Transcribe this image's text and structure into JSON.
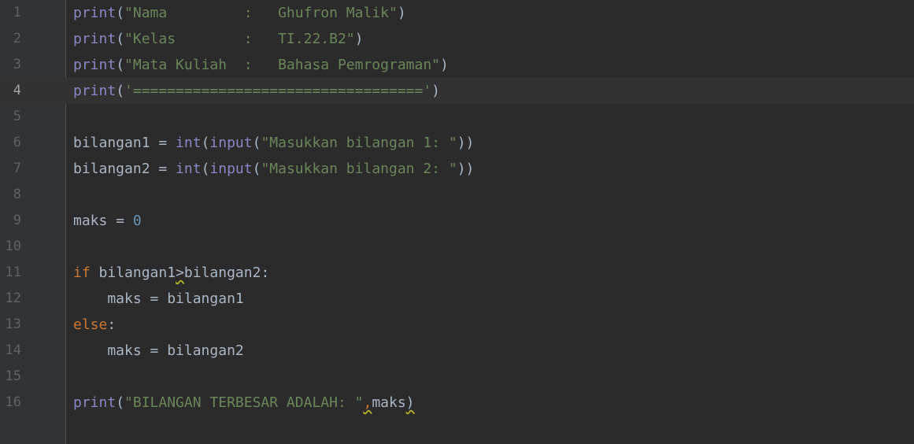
{
  "editor": {
    "current_line": 4,
    "lines": [
      {
        "n": "1",
        "tokens": [
          {
            "t": "print",
            "c": "fn"
          },
          {
            "t": "(",
            "c": "txt"
          },
          {
            "t": "\"Nama         :   Ghufron Malik\"",
            "c": "str"
          },
          {
            "t": ")",
            "c": "txt"
          }
        ]
      },
      {
        "n": "2",
        "tokens": [
          {
            "t": "print",
            "c": "fn"
          },
          {
            "t": "(",
            "c": "txt"
          },
          {
            "t": "\"Kelas        :   TI.22.B2\"",
            "c": "str"
          },
          {
            "t": ")",
            "c": "txt"
          }
        ]
      },
      {
        "n": "3",
        "tokens": [
          {
            "t": "print",
            "c": "fn"
          },
          {
            "t": "(",
            "c": "txt"
          },
          {
            "t": "\"Mata Kuliah  :   Bahasa Pemrograman\"",
            "c": "str"
          },
          {
            "t": ")",
            "c": "txt"
          }
        ]
      },
      {
        "n": "4",
        "tokens": [
          {
            "t": "print",
            "c": "fn"
          },
          {
            "t": "(",
            "c": "txt"
          },
          {
            "t": "'=================================='",
            "c": "str"
          },
          {
            "t": ")",
            "c": "txt"
          }
        ]
      },
      {
        "n": "5",
        "tokens": []
      },
      {
        "n": "6",
        "tokens": [
          {
            "t": "bilangan1 = ",
            "c": "txt"
          },
          {
            "t": "int",
            "c": "fn"
          },
          {
            "t": "(",
            "c": "txt"
          },
          {
            "t": "input",
            "c": "fn"
          },
          {
            "t": "(",
            "c": "txt"
          },
          {
            "t": "\"Masukkan bilangan 1: \"",
            "c": "str"
          },
          {
            "t": "))",
            "c": "txt"
          }
        ]
      },
      {
        "n": "7",
        "tokens": [
          {
            "t": "bilangan2 = ",
            "c": "txt"
          },
          {
            "t": "int",
            "c": "fn"
          },
          {
            "t": "(",
            "c": "txt"
          },
          {
            "t": "input",
            "c": "fn"
          },
          {
            "t": "(",
            "c": "txt"
          },
          {
            "t": "\"Masukkan bilangan 2: \"",
            "c": "str"
          },
          {
            "t": "))",
            "c": "txt"
          }
        ]
      },
      {
        "n": "8",
        "tokens": []
      },
      {
        "n": "9",
        "tokens": [
          {
            "t": "maks = ",
            "c": "txt"
          },
          {
            "t": "0",
            "c": "num"
          }
        ]
      },
      {
        "n": "10",
        "tokens": []
      },
      {
        "n": "11",
        "tokens": [
          {
            "t": "if",
            "c": "kw"
          },
          {
            "t": " bilangan1",
            "c": "txt"
          },
          {
            "t": ">",
            "c": "txt",
            "warn": true
          },
          {
            "t": "bilangan2:",
            "c": "txt"
          }
        ]
      },
      {
        "n": "12",
        "tokens": [
          {
            "t": "    maks = bilangan1",
            "c": "txt"
          }
        ]
      },
      {
        "n": "13",
        "tokens": [
          {
            "t": "else",
            "c": "kw"
          },
          {
            "t": ":",
            "c": "txt"
          }
        ]
      },
      {
        "n": "14",
        "tokens": [
          {
            "t": "    maks = bilangan2",
            "c": "txt"
          }
        ]
      },
      {
        "n": "15",
        "tokens": []
      },
      {
        "n": "16",
        "tokens": [
          {
            "t": "print",
            "c": "fn"
          },
          {
            "t": "(",
            "c": "txt"
          },
          {
            "t": "\"BILANGAN TERBESAR ADALAH: \"",
            "c": "str"
          },
          {
            "t": ",",
            "c": "kw",
            "warn": true
          },
          {
            "t": "maks",
            "c": "txt"
          },
          {
            "t": ")",
            "c": "txt",
            "warn": true
          }
        ]
      }
    ]
  },
  "colors": {
    "background": "#2b2b2b",
    "gutter": "#313335",
    "current_line": "#323232",
    "function": "#8888c6",
    "string": "#6a8759",
    "keyword": "#cc7832",
    "number": "#6897bb",
    "text": "#a9b7c6",
    "line_number": "#606366"
  }
}
